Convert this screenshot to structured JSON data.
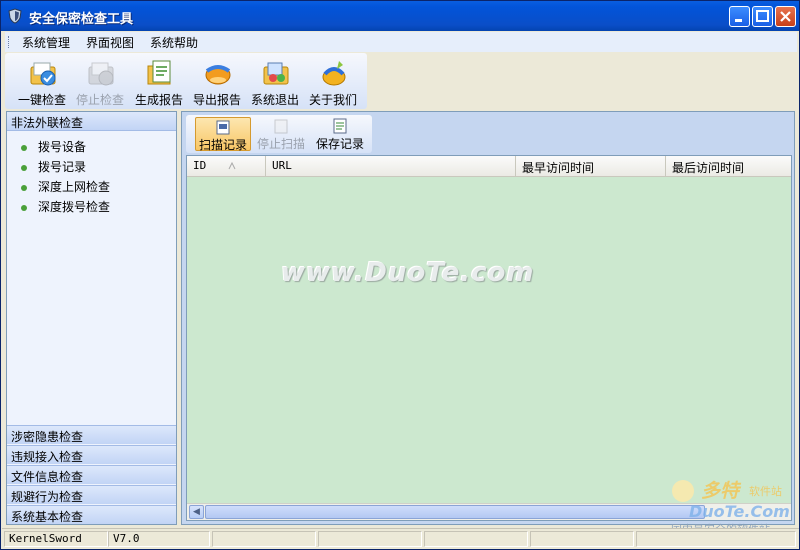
{
  "window": {
    "title": "安全保密检查工具"
  },
  "menu": [
    "系统管理",
    "界面视图",
    "系统帮助"
  ],
  "toolbar": [
    {
      "label": "一键检查",
      "icon": "folder-check-icon",
      "enabled": true
    },
    {
      "label": "停止检查",
      "icon": "stop-check-icon",
      "enabled": false
    },
    {
      "label": "生成报告",
      "icon": "report-icon",
      "enabled": true
    },
    {
      "label": "导出报告",
      "icon": "export-icon",
      "enabled": true
    },
    {
      "label": "系统退出",
      "icon": "exit-icon",
      "enabled": true
    },
    {
      "label": "关于我们",
      "icon": "about-icon",
      "enabled": true
    }
  ],
  "left_panel": {
    "header": "非法外联检查",
    "items": [
      "拨号设备",
      "拨号记录",
      "深度上网检查",
      "深度拨号检查"
    ],
    "bottom_sections": [
      "涉密隐患检查",
      "违规接入检查",
      "文件信息检查",
      "规避行为检查",
      "系统基本检查"
    ]
  },
  "right_toolbar": [
    {
      "label": "扫描记录",
      "active": true,
      "enabled": true
    },
    {
      "label": "停止扫描",
      "active": false,
      "enabled": false
    },
    {
      "label": "保存记录",
      "active": false,
      "enabled": true
    }
  ],
  "grid": {
    "columns": [
      "ID",
      "URL",
      "最早访问时间",
      "最后访问时间"
    ],
    "rows": []
  },
  "watermark": "www.DuoTe.com",
  "status": {
    "left": "KernelSword",
    "version": "V7.0"
  },
  "logo": {
    "brand": "多特软件站",
    "domain": "DuoTe.Com",
    "slogan": "国内最安全的软件站"
  },
  "colors": {
    "titlebar": "#0254d9",
    "grid_bg": "#cce8cf",
    "panel_bg": "#eef3fd"
  }
}
